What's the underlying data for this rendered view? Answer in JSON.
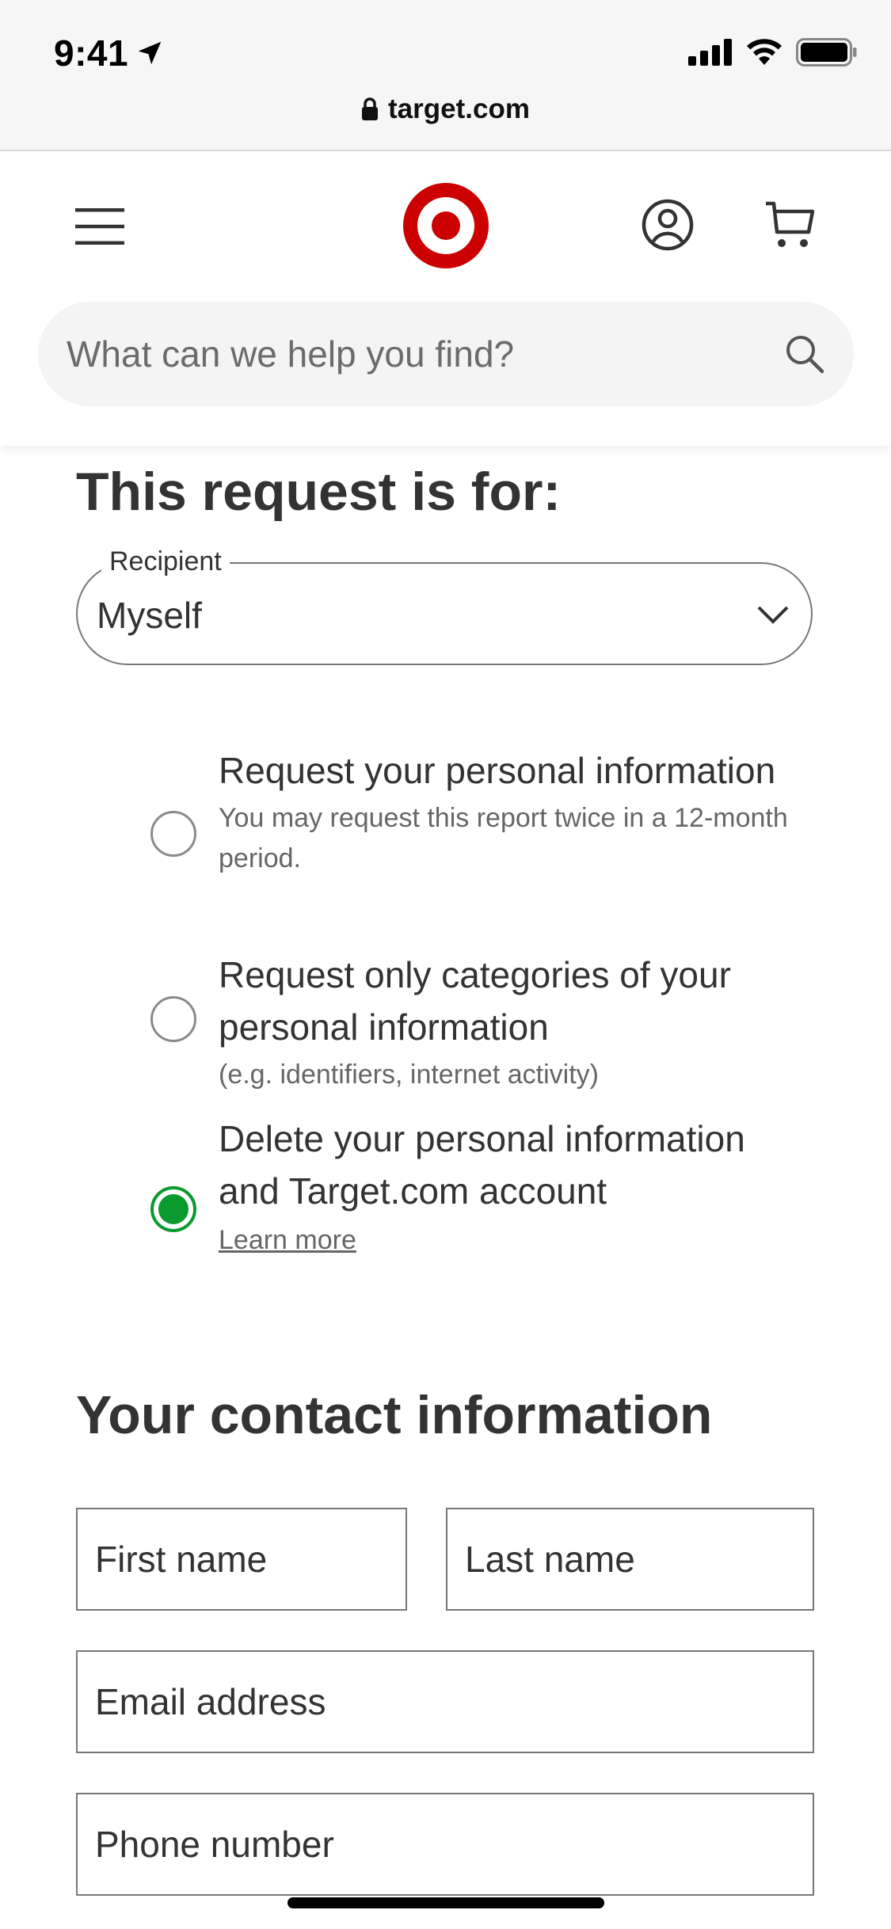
{
  "status_bar": {
    "time": "9:41"
  },
  "browser": {
    "url": "target.com"
  },
  "header": {
    "search_placeholder": "What can we help you find?"
  },
  "request": {
    "title": "This request is for:",
    "recipient_label": "Recipient",
    "recipient_value": "Myself",
    "options": [
      {
        "title": "Request your personal information",
        "desc": "You may request this report twice in a 12-month period.",
        "checked": false
      },
      {
        "title": "Request only categories of your personal information",
        "desc": "(e.g. identifiers, internet activity)",
        "checked": false
      },
      {
        "title": "Delete your personal information and Target.com account",
        "link": "Learn more",
        "checked": true
      }
    ]
  },
  "contact": {
    "title": "Your contact information",
    "first_name_placeholder": "First name",
    "last_name_placeholder": "Last name",
    "email_placeholder": "Email address",
    "phone_placeholder": "Phone number"
  },
  "colors": {
    "brand_red": "#cc0000",
    "selected_green": "#0a9a2e",
    "text": "#333333"
  }
}
